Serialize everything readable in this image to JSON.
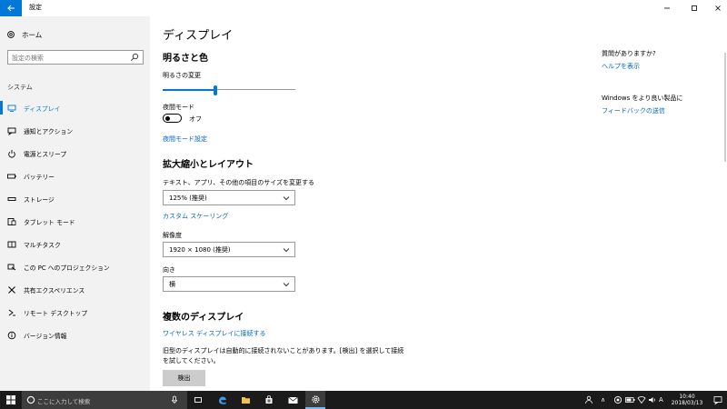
{
  "window": {
    "title": "設定"
  },
  "sidebar": {
    "home_label": "ホーム",
    "search_placeholder": "設定の検索",
    "section_header": "システム",
    "items": [
      {
        "label": "ディスプレイ",
        "icon": "monitor-icon"
      },
      {
        "label": "通知とアクション",
        "icon": "message-icon"
      },
      {
        "label": "電源とスリープ",
        "icon": "power-icon"
      },
      {
        "label": "バッテリー",
        "icon": "battery-icon"
      },
      {
        "label": "ストレージ",
        "icon": "storage-icon"
      },
      {
        "label": "タブレット モード",
        "icon": "tablet-icon"
      },
      {
        "label": "マルチタスク",
        "icon": "multitask-icon"
      },
      {
        "label": "この PC へのプロジェクション",
        "icon": "projection-icon"
      },
      {
        "label": "共有エクスペリエンス",
        "icon": "shared-icon"
      },
      {
        "label": "リモート デスクトップ",
        "icon": "remote-desktop-icon"
      },
      {
        "label": "バージョン情報",
        "icon": "info-icon"
      }
    ]
  },
  "main": {
    "page_title": "ディスプレイ",
    "brightness": {
      "section_title": "明るさと色",
      "slider_label": "明るさの変更",
      "value_fraction": 0.4,
      "night_light_label": "夜間モード",
      "night_light_state": "オフ",
      "night_light_settings_link": "夜間モード設定"
    },
    "scale_layout": {
      "section_title": "拡大縮小とレイアウト",
      "scale_label": "テキスト、アプリ、その他の項目のサイズを変更する",
      "scale_value": "125% (推奨)",
      "custom_scaling_link": "カスタム スケーリング",
      "resolution_label": "解像度",
      "resolution_value": "1920 × 1080 (推奨)",
      "orientation_label": "向き",
      "orientation_value": "横"
    },
    "multiple": {
      "section_title": "複数のディスプレイ",
      "wireless_link": "ワイヤレス ディスプレイに接続する",
      "description": "旧型のディスプレイは自動的に接続されないことがあります。[検出] を選択して接続を試してください。",
      "detect_button": "検出"
    }
  },
  "right_panel": {
    "question": "質問がありますか?",
    "help_link": "ヘルプを表示",
    "improve_text": "Windows をより良い製品に",
    "feedback_link": "フィードバックの送信"
  },
  "taskbar": {
    "search_placeholder": "ここに入力して検索",
    "ime": "A",
    "time": "10:40",
    "date": "2018/03/13",
    "accent_color": "#76b9ed"
  },
  "colors": {
    "accent": "#0078d7",
    "link": "#0066cc",
    "sidebar_bg": "#f2f2f2",
    "taskbar_bg": "#1b1b1b"
  }
}
